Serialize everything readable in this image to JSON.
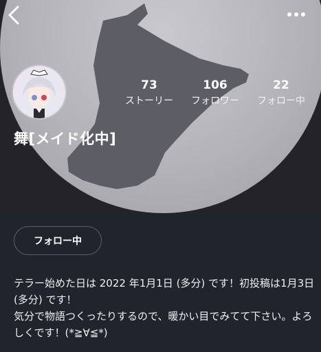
{
  "profile": {
    "name": "舞[メイド化中]",
    "avatar_icon": "maid-girl-avatar",
    "header_image": "cat-silhouette-on-moon"
  },
  "stats": [
    {
      "value": "73",
      "label": "ストーリー"
    },
    {
      "value": "106",
      "label": "フォロワー"
    },
    {
      "value": "22",
      "label": "フォロー中"
    }
  ],
  "actions": {
    "follow_label": "フォロー中",
    "back_icon": "back-chevron-icon",
    "more_icon": "more-dots-icon"
  },
  "bio": {
    "line1": "テラー始めた日は 2022 年1月1日 (多分) です！初投稿は1月3日 (多分) です！",
    "line2": "気分で物語つくったりするので、暖かい目でみてて下さい。よろしくです！(*≧∀≦*)"
  },
  "colors": {
    "background": "#20242c",
    "moon": "#bdbdc2",
    "cat_silhouette": "#5e5e66",
    "button_border": "#5a606a"
  }
}
